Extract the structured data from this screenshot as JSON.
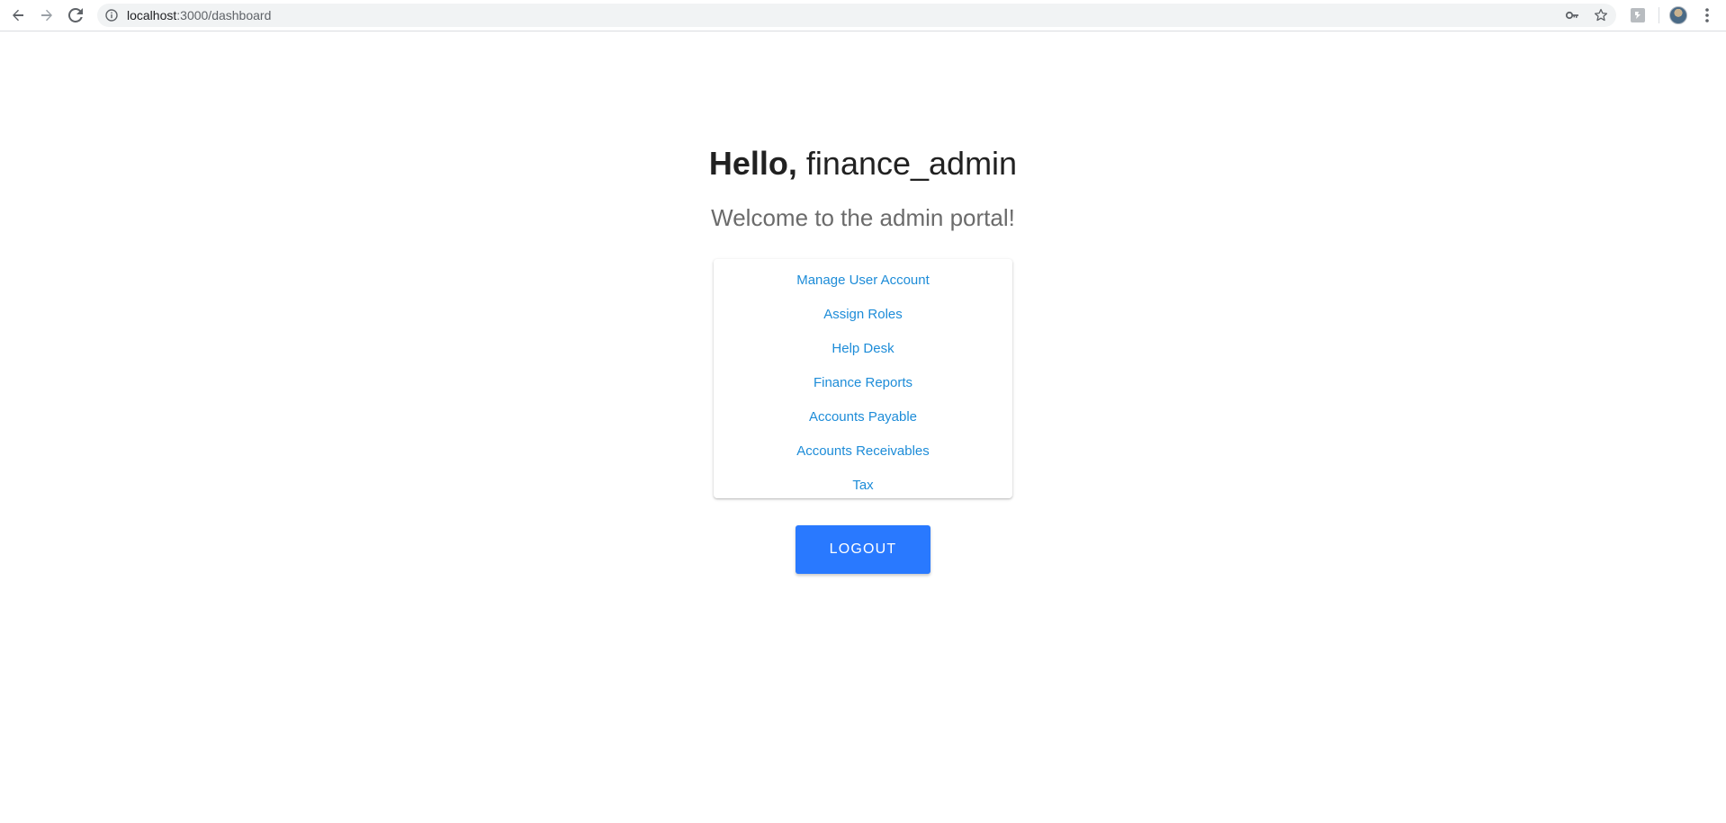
{
  "browser": {
    "url_host": "localhost",
    "url_path": ":3000/dashboard",
    "icons": {
      "back": "arrow-left-icon",
      "forward": "arrow-right-icon",
      "reload": "reload-icon",
      "info": "info-icon",
      "key": "key-icon",
      "star": "star-icon",
      "extension": "extension-icon",
      "menu": "kebab-menu-icon"
    }
  },
  "page": {
    "greeting_bold": "Hello,",
    "username": "finance_admin",
    "welcome": "Welcome to the admin portal!",
    "menu_items": [
      {
        "label": "Manage User Account"
      },
      {
        "label": "Assign Roles"
      },
      {
        "label": "Help Desk"
      },
      {
        "label": "Finance Reports"
      },
      {
        "label": "Accounts Payable"
      },
      {
        "label": "Accounts Receivables"
      },
      {
        "label": "Tax"
      }
    ],
    "logout_label": "LOGOUT"
  },
  "colors": {
    "link": "#1d8cd8",
    "button": "#2979ff",
    "heading": "#212121",
    "subheading": "#6b6b6b"
  }
}
